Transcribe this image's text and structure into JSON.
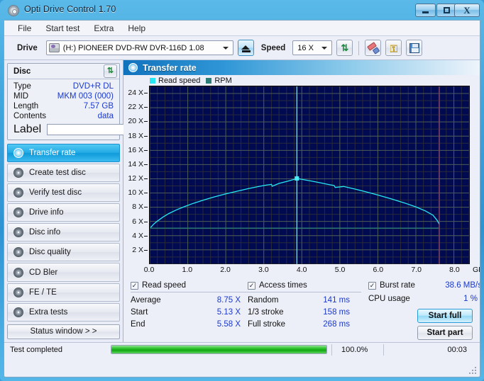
{
  "window": {
    "title": "Opti Drive Control 1.70",
    "icon": "disc-icon",
    "minimize_label": "–",
    "maximize_label": "□",
    "close_label": "X"
  },
  "menubar": {
    "items": [
      {
        "label": "File"
      },
      {
        "label": "Start test"
      },
      {
        "label": "Extra"
      },
      {
        "label": "Help"
      }
    ]
  },
  "toolbar": {
    "drive_label": "Drive",
    "drive_value": "(H:)  PIONEER DVD-RW  DVR-116D 1.08",
    "eject_icon": "eject-icon",
    "speed_label": "Speed",
    "speed_value": "16 X",
    "refresh_icon": "refresh-icon",
    "erase_icon": "eraser-icon",
    "key_icon": "key-icon",
    "save_icon": "save-icon"
  },
  "disc_panel": {
    "title": "Disc",
    "refresh_icon": "refresh-icon",
    "rows": [
      {
        "key": "Type",
        "value": "DVD+R DL"
      },
      {
        "key": "MID",
        "value": "MKM 003 (000)"
      },
      {
        "key": "Length",
        "value": "7.57 GB"
      },
      {
        "key": "Contents",
        "value": "data"
      }
    ],
    "label_key": "Label",
    "label_value": "",
    "label_placeholder": "",
    "label_disc_icon": "cd-icon"
  },
  "nav": {
    "items": [
      {
        "label": "Transfer rate",
        "icon": "transfer-rate-icon",
        "active": true
      },
      {
        "label": "Create test disc",
        "icon": "create-test-disc-icon",
        "active": false
      },
      {
        "label": "Verify test disc",
        "icon": "verify-test-disc-icon",
        "active": false
      },
      {
        "label": "Drive info",
        "icon": "drive-info-icon",
        "active": false
      },
      {
        "label": "Disc info",
        "icon": "disc-info-icon",
        "active": false
      },
      {
        "label": "Disc quality",
        "icon": "disc-quality-icon",
        "active": false
      },
      {
        "label": "CD Bler",
        "icon": "cd-bler-icon",
        "active": false
      },
      {
        "label": "FE / TE",
        "icon": "fe-te-icon",
        "active": false
      },
      {
        "label": "Extra tests",
        "icon": "extra-tests-icon",
        "active": false
      }
    ],
    "status_window_label": "Status window > >"
  },
  "panel": {
    "title": "Transfer rate",
    "icon": "transfer-rate-icon"
  },
  "chart_data": {
    "type": "line",
    "title": "Transfer rate",
    "xlabel": "GB",
    "ylabel": "X",
    "xlim": [
      0,
      8.4
    ],
    "ylim": [
      0,
      25
    ],
    "grid": true,
    "legend_position": "top-left",
    "plot_bg": "#000a50",
    "x_unit": "GB",
    "x_ticks": [
      0.0,
      1.0,
      2.0,
      3.0,
      4.0,
      5.0,
      6.0,
      7.0,
      8.0
    ],
    "x_tick_labels": [
      "0.0",
      "1.0",
      "2.0",
      "3.0",
      "4.0",
      "5.0",
      "6.0",
      "7.0",
      "8.0"
    ],
    "y_ticks": [
      2,
      4,
      6,
      8,
      10,
      12,
      14,
      16,
      18,
      20,
      22,
      24
    ],
    "y_tick_labels": [
      "2 X",
      "4 X",
      "6 X",
      "8 X",
      "10 X",
      "12 X",
      "14 X",
      "16 X",
      "18 X",
      "20 X",
      "22 X",
      "24 X"
    ],
    "legend": [
      {
        "name": "Read speed",
        "color": "#25e8f4"
      },
      {
        "name": "RPM",
        "color": "#2c7d77"
      }
    ],
    "markers": {
      "layer_break_x": 3.87,
      "layer_break_color": "#8fe3f7",
      "disc_end_x": 7.62,
      "disc_end_color": "#a0306c",
      "peak_point": {
        "x": 3.87,
        "y": 12.05,
        "color": "#49ecf8"
      }
    },
    "series": [
      {
        "name": "Read speed",
        "color": "#25e8f4",
        "x": [
          0.02,
          0.1,
          0.2,
          0.35,
          0.5,
          0.7,
          0.9,
          1.15,
          1.4,
          1.7,
          2.0,
          2.3,
          2.6,
          2.85,
          3.05,
          3.2,
          3.22,
          3.4,
          3.6,
          3.8,
          3.87,
          4.0,
          4.25,
          4.5,
          4.7,
          4.85,
          4.88,
          5.1,
          5.4,
          5.7,
          6.0,
          6.35,
          6.7,
          7.0,
          7.25,
          7.45,
          7.56,
          7.62
        ],
        "y": [
          5.13,
          5.6,
          6.05,
          6.62,
          7.1,
          7.62,
          8.06,
          8.55,
          8.98,
          9.45,
          9.88,
          10.25,
          10.62,
          10.9,
          11.1,
          11.22,
          10.95,
          11.35,
          11.62,
          11.92,
          12.05,
          11.92,
          11.68,
          11.42,
          11.2,
          11.05,
          10.78,
          10.92,
          10.55,
          10.15,
          9.72,
          9.18,
          8.6,
          8.05,
          7.48,
          6.88,
          6.15,
          5.58
        ]
      },
      {
        "name": "RPM",
        "color": "#2c7d77",
        "x": [
          0.02,
          1.0,
          2.0,
          3.0,
          4.0,
          5.0,
          6.0,
          7.0,
          7.62
        ],
        "y": [
          5.05,
          5.05,
          5.05,
          5.05,
          5.05,
          5.05,
          5.05,
          5.05,
          5.05
        ]
      }
    ]
  },
  "stats": {
    "read_speed": {
      "checked": true,
      "title": "Read speed",
      "rows": [
        {
          "key": "Average",
          "value": "8.75 X"
        },
        {
          "key": "Start",
          "value": "5.13 X"
        },
        {
          "key": "End",
          "value": "5.58 X"
        }
      ]
    },
    "access_times": {
      "checked": true,
      "title": "Access times",
      "rows": [
        {
          "key": "Random",
          "value": "141 ms"
        },
        {
          "key": "1/3 stroke",
          "value": "158 ms"
        },
        {
          "key": "Full stroke",
          "value": "268 ms"
        }
      ]
    },
    "burst_rate": {
      "checked": true,
      "title": "Burst rate",
      "value": "38.6 MB/s",
      "rows": [
        {
          "key": "CPU usage",
          "value": "1 %"
        }
      ]
    },
    "buttons": {
      "start_full": "Start full",
      "start_part": "Start part"
    }
  },
  "statusbar": {
    "text": "Test completed",
    "progress_percent": "100.0%",
    "progress_value": 100,
    "elapsed": "00:03"
  }
}
